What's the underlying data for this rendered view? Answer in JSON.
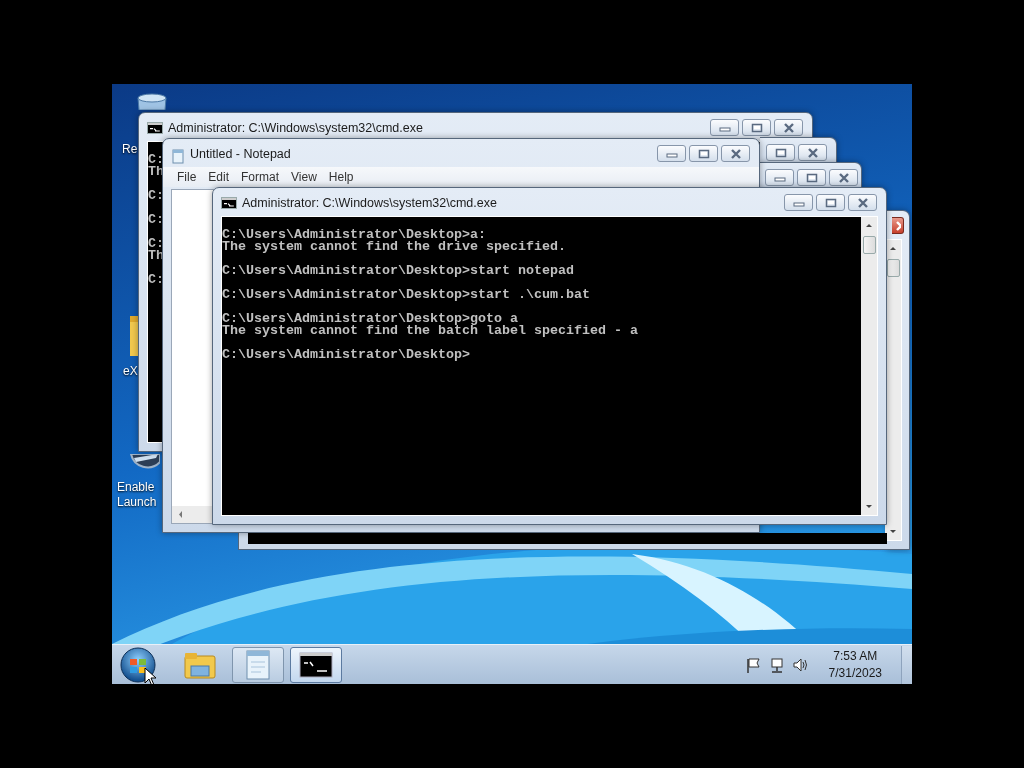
{
  "desktop_icons": [
    {
      "kind": "recycle_bin",
      "label_lines": [
        "Re"
      ]
    },
    {
      "kind": "folder",
      "label_lines": [
        "eX"
      ]
    },
    {
      "kind": "shortcut",
      "label_lines": [
        "Enable",
        "Launch"
      ]
    }
  ],
  "windows": [
    {
      "kind": "console",
      "title": "Administrator: C:\\Windows\\system32\\cmd.exe",
      "active": false,
      "caption_buttons": [
        {
          "kind": "minimize"
        },
        {
          "kind": "maximize"
        },
        {
          "kind": "close"
        }
      ],
      "blocks": [
        [
          "C:",
          "Th"
        ],
        [
          "C:"
        ],
        [
          "C:"
        ],
        [
          "C:",
          "Th"
        ],
        [
          "C:"
        ]
      ]
    },
    {
      "kind": "frame",
      "active": false,
      "caption_buttons": [
        {
          "kind": "maximize"
        },
        {
          "kind": "close"
        }
      ]
    },
    {
      "kind": "frame",
      "active": false,
      "caption_buttons": [
        {
          "kind": "minimize"
        },
        {
          "kind": "maximize"
        },
        {
          "kind": "close"
        }
      ]
    },
    {
      "kind": "console",
      "active": true,
      "scrollbar": true,
      "caption_buttons": [
        {
          "kind": "close",
          "cut": true
        }
      ]
    },
    {
      "kind": "notepad",
      "title": "Untitled - Notepad",
      "active": false,
      "caption_buttons": [
        {
          "kind": "minimize"
        },
        {
          "kind": "maximize"
        },
        {
          "kind": "close"
        }
      ],
      "menu": [
        "File",
        "Edit",
        "Format",
        "View",
        "Help"
      ]
    },
    {
      "kind": "console",
      "title": "Administrator: C:\\Windows\\system32\\cmd.exe",
      "active": false,
      "scrollbar": true,
      "caption_buttons": [
        {
          "kind": "minimize"
        },
        {
          "kind": "maximize"
        },
        {
          "kind": "close"
        }
      ],
      "blocks": [
        [
          "C:\\Users\\Administrator\\Desktop>a:",
          "The system cannot find the drive specified."
        ],
        [
          "C:\\Users\\Administrator\\Desktop>start notepad"
        ],
        [
          "C:\\Users\\Administrator\\Desktop>start .\\cum.bat"
        ],
        [
          "C:\\Users\\Administrator\\Desktop>goto a",
          "The system cannot find the batch label specified - a"
        ],
        [
          "C:\\Users\\Administrator\\Desktop>"
        ]
      ]
    }
  ],
  "taskbar": {
    "items": [
      {
        "kind": "start",
        "running": false,
        "selected": false
      },
      {
        "kind": "explorer",
        "running": false,
        "selected": false
      },
      {
        "kind": "notepad",
        "running": true,
        "selected": false
      },
      {
        "kind": "console",
        "running": true,
        "selected": true
      }
    ],
    "tray_icons": [
      {
        "kind": "flag"
      },
      {
        "kind": "network"
      },
      {
        "kind": "volume"
      }
    ],
    "time": "7:53 AM",
    "date": "7/31/2023"
  }
}
